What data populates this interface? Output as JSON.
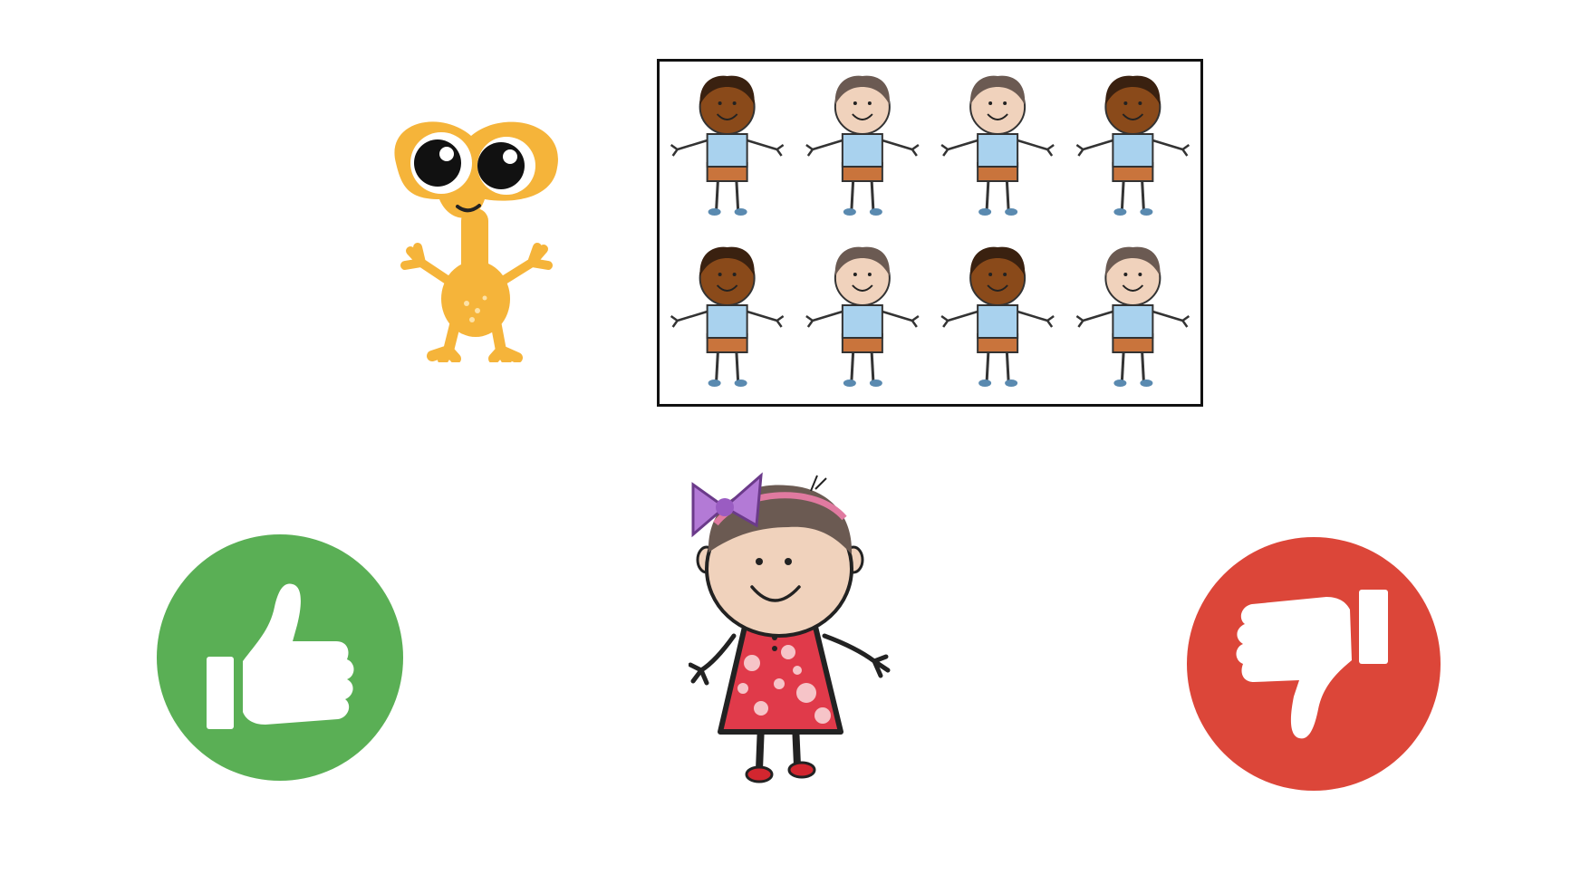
{
  "colors": {
    "background": "#ffffff",
    "thumbs_up_circle": "#5aaf55",
    "thumbs_down_circle": "#dc4639",
    "alien_body": "#f5b43a",
    "panel_border": "#111111",
    "girl_dress": "#e03a4a",
    "girl_bow": "#b37ad6",
    "boy_shirt": "#a9d2ee",
    "boy_shorts": "#c9743c",
    "dark_skin": "#8a4a1a",
    "light_skin": "#f0d2bc",
    "dark_hair": "#3a2110",
    "brown_hair": "#6b5a52"
  },
  "icons": {
    "alien": "alien-character-icon",
    "girl": "girl-character-icon",
    "boy": "boy-character-icon",
    "approve": "thumbs-up-icon",
    "reject": "thumbs-down-icon"
  },
  "boys_panel": {
    "rows": 2,
    "cols": 4,
    "skin_tones": [
      "dark",
      "light",
      "light",
      "dark",
      "dark",
      "light",
      "dark",
      "light"
    ]
  }
}
